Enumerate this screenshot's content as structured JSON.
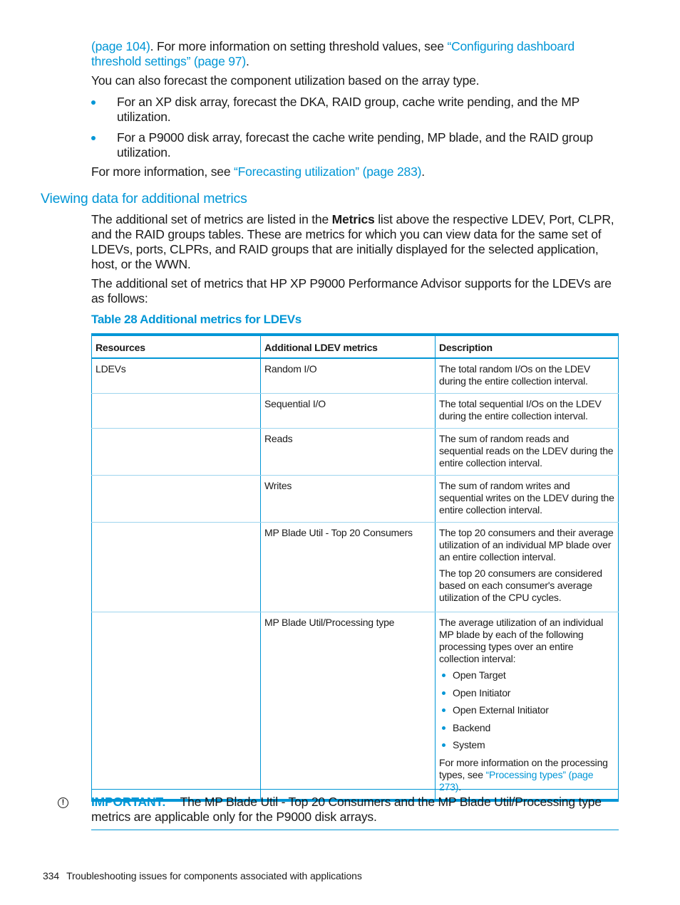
{
  "intro": {
    "line1_link_start": "(page 104)",
    "line1_text": ". For more information on setting threshold values, see ",
    "line1_link": "“Configuring dashboard threshold settings” (page 97)",
    "line1_end": ".",
    "forecast_text": "You can also forecast the component utilization based on the array type.",
    "bullets": [
      "For an XP disk array, forecast the DKA, RAID group, cache write pending, and the MP utilization.",
      "For a P9000 disk array, forecast the cache write pending, MP blade, and the RAID group utilization."
    ],
    "more_info_text": "For more information, see ",
    "more_info_link": "“Forecasting utilization” (page 283)",
    "more_info_end": "."
  },
  "section": {
    "heading": "Viewing data for additional metrics",
    "para1_start": "The additional set of metrics are listed in the ",
    "para1_bold": "Metrics",
    "para1_end": " list above the respective LDEV, Port, CLPR, and the RAID groups tables. These are metrics for which you can view data for the same set of LDEVs, ports, CLPRs, and RAID groups that are initially displayed for the selected application, host, or the WWN.",
    "para2": "The additional set of metrics that HP XP P9000 Performance Advisor supports for the LDEVs are as follows:"
  },
  "table": {
    "caption": "Table 28 Additional metrics for LDEVs",
    "headers": [
      "Resources",
      "Additional LDEV metrics",
      "Description"
    ],
    "rows": [
      {
        "resource": "LDEVs",
        "metric": "Random I/O",
        "description": [
          "The total random I/Os on the LDEV during the entire collection interval."
        ]
      },
      {
        "resource": "",
        "metric": "Sequential I/O",
        "description": [
          "The total sequential I/Os on the LDEV during the entire collection interval."
        ]
      },
      {
        "resource": "",
        "metric": "Reads",
        "description": [
          "The sum of random reads and sequential reads on the LDEV during the entire collection interval."
        ]
      },
      {
        "resource": "",
        "metric": "Writes",
        "description": [
          "The sum of random writes and sequential writes on the LDEV during the entire collection interval."
        ]
      },
      {
        "resource": "",
        "metric": "MP Blade Util - Top 20 Consumers",
        "description": [
          "The top 20 consumers and their average utilization of an individual MP blade over an entire collection interval.",
          "The top 20 consumers are considered based on each consumer's average utilization of the CPU cycles."
        ]
      },
      {
        "resource": "",
        "metric": "MP Blade Util/Processing type",
        "description_intro": "The average utilization of an individual MP blade by each of the following processing types over an entire collection interval:",
        "description_list": [
          "Open Target",
          "Open Initiator",
          "Open External Initiator",
          "Backend",
          "System"
        ],
        "description_outro_text": "For more information on the processing types, see ",
        "description_outro_link": "“Processing types” (page 273)",
        "description_outro_end": "."
      }
    ]
  },
  "important": {
    "icon": "exclamation-circle-icon",
    "label": "IMPORTANT:",
    "text": "The MP Blade Util - Top 20 Consumers and the MP Blade Util/Processing type metrics are applicable only for the P9000 disk arrays."
  },
  "footer": {
    "page_number": "334",
    "title": "Troubleshooting issues for components associated with applications"
  },
  "colors": {
    "accent": "#0096d6",
    "text": "#1a1a1a"
  }
}
